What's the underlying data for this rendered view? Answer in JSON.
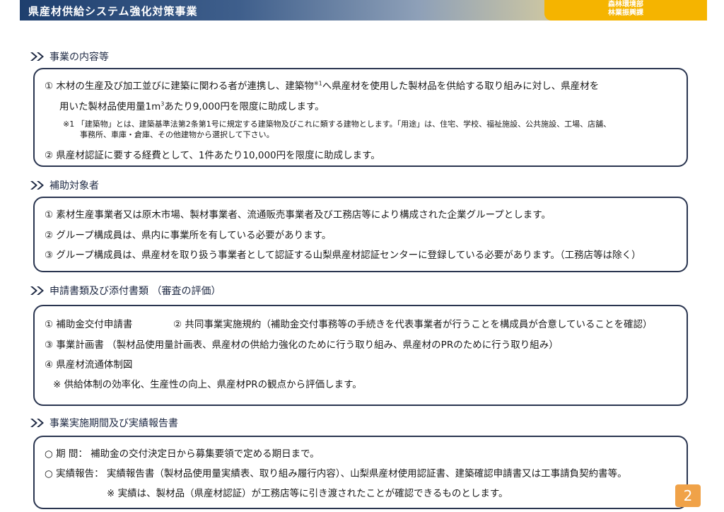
{
  "header": {
    "title": "県産材供給システム強化対策事業",
    "dept_line1": "森林環境部",
    "dept_line2": "林業振興課"
  },
  "sections": {
    "s1": {
      "title": "事業の内容等",
      "item1_a_pre": "①  木材の生産及び加工並びに建築に関わる者が連携し、建築物",
      "item1_a_sup": "※1",
      "item1_a_post": "へ県産材を使用した製材品を供給する取り組みに対し、県産材を",
      "item1_b_pre": "用いた製材品使用量1m",
      "item1_b_sup": "3",
      "item1_b_post": "あたり9,000円を限度に助成します。",
      "note1_a": "※1 「建築物」とは、建築基準法第2条第1号に規定する建築物及びこれに類する建物とします。「用途」は、住宅、学校、福祉施設、公共施設、工場、店舗、",
      "note1_b": "事務所、車庫・倉庫、その他建物から選択して下さい。",
      "item2": "②  県産材認証に要する経費として、1件あたり10,000円を限度に助成します。"
    },
    "s2": {
      "title": "補助対象者",
      "item1": "①  素材生産事業者又は原木市場、製材事業者、流通販売事業者及び工務店等により構成された企業グループとします。",
      "item2": "②  グループ構成員は、県内に事業所を有している必要があります。",
      "item3": "③  グループ構成員は、県産材を取り扱う事業者として認証する山梨県産材認証センターに登録している必要があります。（工務店等は除く）"
    },
    "s3": {
      "title": "申請書類及び添付書類 （審査の評価）",
      "item1": "①  補助金交付申請書",
      "item2": "②  共同事業実施規約（補助金交付事務等の手続きを代表事業者が行うことを構成員が合意していることを確認）",
      "item3": "③  事業計画書 （製材品使用量計画表、県産材の供給力強化のために行う取り組み、県産材のPRのために行う取り組み）",
      "item4": "④  県産材流通体制図",
      "note": "※ 供給体制の効率化、生産性の向上、県産材PRの観点から評価します。"
    },
    "s4": {
      "title": "事業実施期間及び実績報告書",
      "item1": "○  期   間： 補助金の交付決定日から募集要領で定める期日まで。",
      "item2": "○  実績報告： 実績報告書（製材品使用量実績表、取り組み履行内容）、山梨県産材使用認証書、建築確認申請書又は工事請負契約書等。",
      "note": "※ 実績は、製材品（県産材認証）が工務店等に引き渡されたことが確認できるものとします。"
    }
  },
  "page_number": "2",
  "colors": {
    "header_navy": "#1e3f6e",
    "header_gold": "#f5b400",
    "box_border": "#2a3550",
    "page_badge": "#f0a248"
  },
  "icons": {
    "section_marker": "double-chevron-right-icon"
  }
}
